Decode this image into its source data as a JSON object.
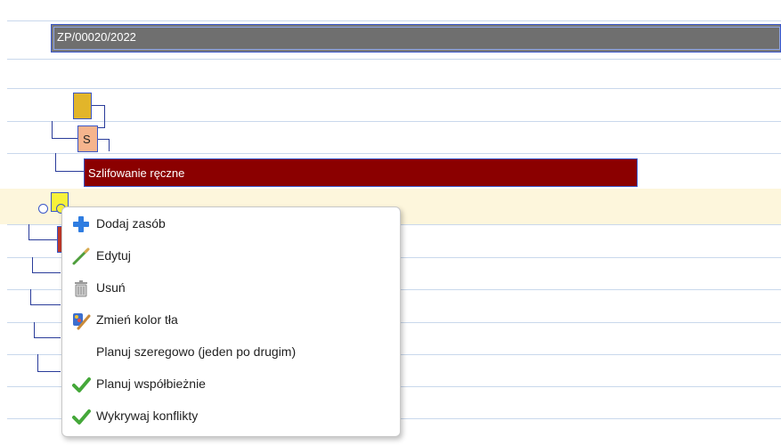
{
  "order": {
    "number": "ZP/00020/2022"
  },
  "tasks": {
    "grinding_label": "Szlifowanie ręczne",
    "s_label": "S"
  },
  "context_menu": {
    "items": [
      {
        "label": "Dodaj zasób",
        "icon": "plus-icon"
      },
      {
        "label": "Edytuj",
        "icon": "pencil-icon"
      },
      {
        "label": "Usuń",
        "icon": "trash-icon"
      },
      {
        "label": "Zmień kolor tła",
        "icon": "paint-icon"
      },
      {
        "label": "Planuj szeregowo (jeden po drugim)",
        "icon": ""
      },
      {
        "label": "Planuj współbieżnie",
        "icon": "checkmark-icon"
      },
      {
        "label": "Wykrywaj konflikty",
        "icon": "checkmark-icon"
      }
    ]
  },
  "colors": {
    "grinding_bar": "#8b0000",
    "accent_border": "#3a57c8",
    "yellow_task": "#e2b52a",
    "orange_task": "#f6b48d"
  }
}
